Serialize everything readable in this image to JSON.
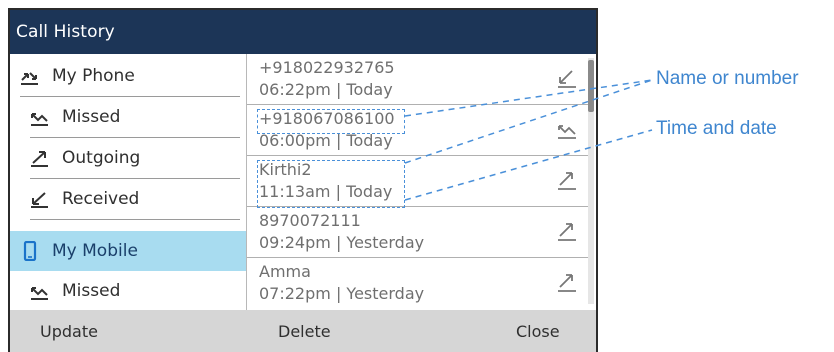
{
  "window": {
    "title": "Call History"
  },
  "sidebar": {
    "items": [
      {
        "label": "My Phone",
        "icon": "phone-log-icon"
      },
      {
        "label": "Missed",
        "icon": "missed-call-icon"
      },
      {
        "label": "Outgoing",
        "icon": "outgoing-call-icon"
      },
      {
        "label": "Received",
        "icon": "received-call-icon"
      },
      {
        "label": "My Mobile",
        "icon": "mobile-phone-icon",
        "selected": true
      },
      {
        "label": "Missed",
        "icon": "missed-call-icon"
      }
    ]
  },
  "calls": [
    {
      "name": "+918022932765",
      "time": "06:22pm | Today",
      "type_icon": "received-call-icon"
    },
    {
      "name": "+918067086100",
      "time": "06:00pm | Today",
      "type_icon": "missed-call-icon"
    },
    {
      "name": "Kirthi2",
      "time": "11:13am | Today",
      "type_icon": "outgoing-call-icon"
    },
    {
      "name": "8970072111",
      "time": "09:24pm | Yesterday",
      "type_icon": "outgoing-call-icon"
    },
    {
      "name": "Amma",
      "time": "07:22pm | Yesterday",
      "type_icon": "outgoing-call-icon"
    }
  ],
  "softkeys": {
    "left": "Update",
    "center": "Delete",
    "right": "Close"
  },
  "annotations": {
    "name_label": "Name or number",
    "time_label": "Time and date"
  },
  "colors": {
    "titlebar": "#1c3557",
    "selected": "#a8dcf0",
    "softkey_bar": "#d6d6d6",
    "annotation": "#3f86cf"
  }
}
